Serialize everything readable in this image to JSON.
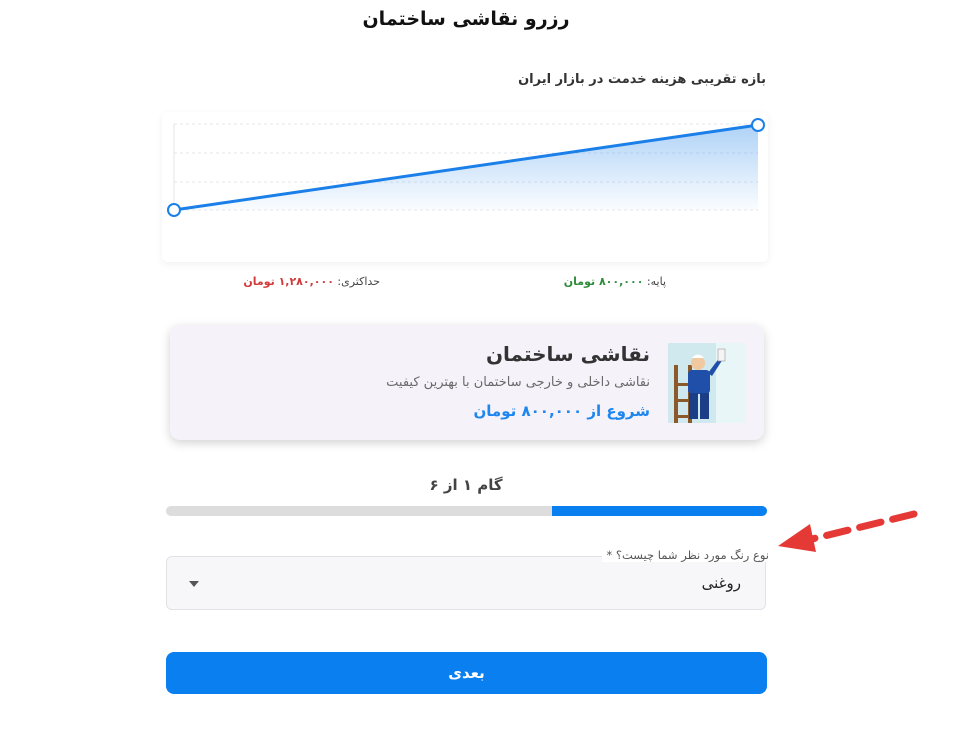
{
  "page": {
    "title": "رزرو نقاشی ساختمان"
  },
  "price_range": {
    "chart_title": "بازه تقریبی هزینه خدمت در بازار ایران",
    "base_label": "پایه:",
    "base_value": "۸۰۰,۰۰۰ تومان",
    "max_label": "حداکثری:",
    "max_value": "۱,۲۸۰,۰۰۰ تومان",
    "colors": {
      "line": "#1a7fe8",
      "base": "#2e8b3a",
      "max": "#d23a3a"
    }
  },
  "chart_data": {
    "type": "area",
    "x": [
      0,
      1
    ],
    "values": [
      800000,
      1280000
    ],
    "title": "بازه تقریبی هزینه خدمت در بازار ایران",
    "grid": true
  },
  "service": {
    "name": "نقاشی ساختمان",
    "description": "نقاشی داخلی و خارجی ساختمان با بهترین کیفیت",
    "price": "شروع از ۸۰۰,۰۰۰ تومان",
    "image_icon": "painter-on-ladder"
  },
  "wizard": {
    "step_label": "گام ۱ از ۶",
    "current_step": 1,
    "total_steps": 6,
    "progress_fraction": 0.357
  },
  "form": {
    "paint_type_label": "نوع رنگ مورد نظر شما چیست؟ *",
    "paint_type_value": "روغنی"
  },
  "actions": {
    "next_label": "بعدی"
  },
  "annotation": {
    "arrow_color": "#e53935",
    "icon": "dashed-arrow-icon"
  }
}
